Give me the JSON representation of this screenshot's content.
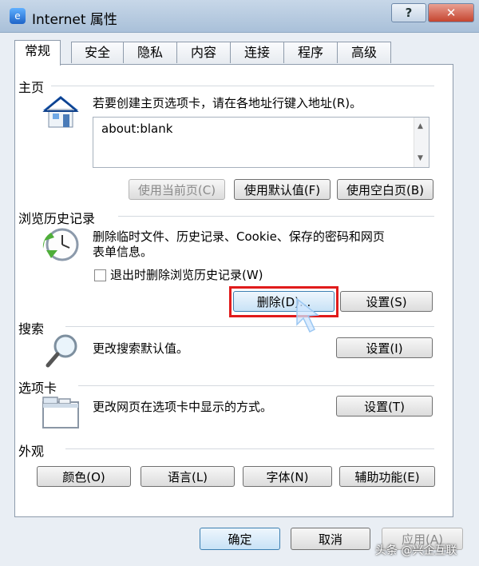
{
  "window": {
    "title": "Internet 属性",
    "help_label": "?",
    "close_label": "✕"
  },
  "tabs": [
    {
      "label": "常规",
      "active": true
    },
    {
      "label": "安全"
    },
    {
      "label": "隐私"
    },
    {
      "label": "内容"
    },
    {
      "label": "连接"
    },
    {
      "label": "程序"
    },
    {
      "label": "高级"
    }
  ],
  "homepage": {
    "title": "主页",
    "description": "若要创建主页选项卡，请在各地址行键入地址(R)。",
    "url": "about:blank",
    "use_current_label": "使用当前页(C)",
    "use_default_label": "使用默认值(F)",
    "use_blank_label": "使用空白页(B)"
  },
  "history": {
    "title": "浏览历史记录",
    "description_line1": "删除临时文件、历史记录、Cookie、保存的密码和网页",
    "description_line2": "表单信息。",
    "delete_on_exit_label": "退出时删除浏览历史记录(W)",
    "delete_on_exit_checked": false,
    "delete_label": "删除(D)...",
    "settings_label": "设置(S)"
  },
  "search": {
    "title": "搜索",
    "description": "更改搜索默认值。",
    "settings_label": "设置(I)"
  },
  "tabs_section": {
    "title": "选项卡",
    "description": "更改网页在选项卡中显示的方式。",
    "settings_label": "设置(T)"
  },
  "appearance": {
    "title": "外观",
    "colors_label": "颜色(O)",
    "languages_label": "语言(L)",
    "fonts_label": "字体(N)",
    "accessibility_label": "辅助功能(E)"
  },
  "footer": {
    "ok_label": "确定",
    "cancel_label": "取消",
    "apply_label": "应用(A)"
  },
  "watermark": "头条 @兴企互联"
}
